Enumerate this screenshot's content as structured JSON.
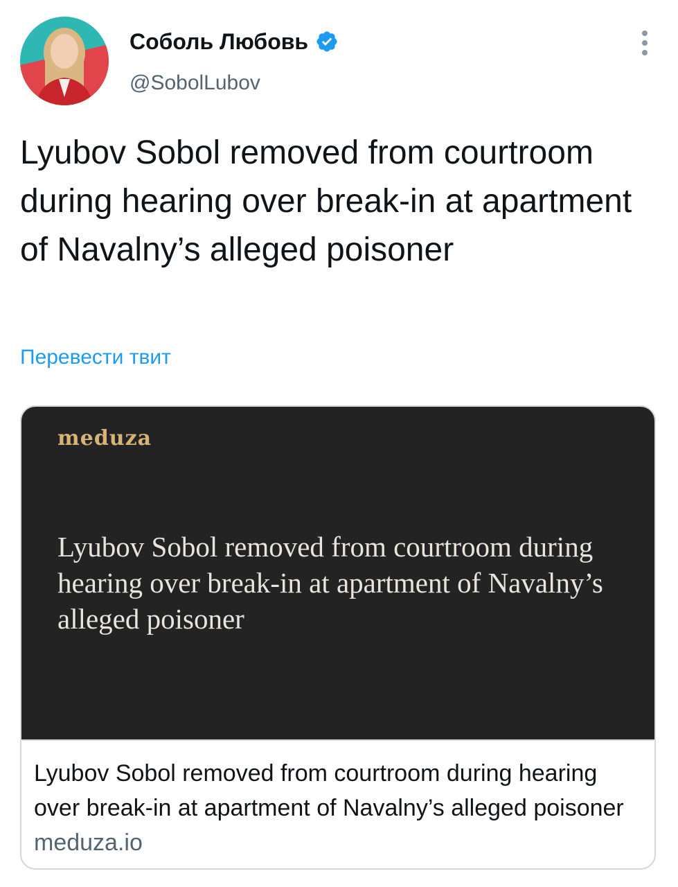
{
  "author": {
    "display_name": "Соболь Любовь",
    "handle": "@SobolLubov",
    "verified": true
  },
  "tweet": {
    "text": "Lyubov Sobol removed from courtroom during hearing over break-in at apartment of Navalny’s alleged poisoner",
    "translate_label": "Перевести твит"
  },
  "card": {
    "logo_text": "meduza",
    "image_headline": "Lyubov Sobol removed from courtroom during hearing over break-in at apartment of Navalny’s alleged poisoner",
    "title": "Lyubov Sobol removed from courtroom during hearing over break-in at apartment of Navalny’s alleged poisoner",
    "domain": "meduza.io"
  },
  "icons": {
    "verified": "verified-badge-icon",
    "more": "more-options-icon"
  },
  "colors": {
    "accent": "#1d9bf0",
    "secondary_text": "#536471",
    "card_image_bg": "#232323",
    "logo_gold": "#d8b377",
    "avatar_teal": "#2fb7b3",
    "avatar_red": "#e2444c"
  }
}
